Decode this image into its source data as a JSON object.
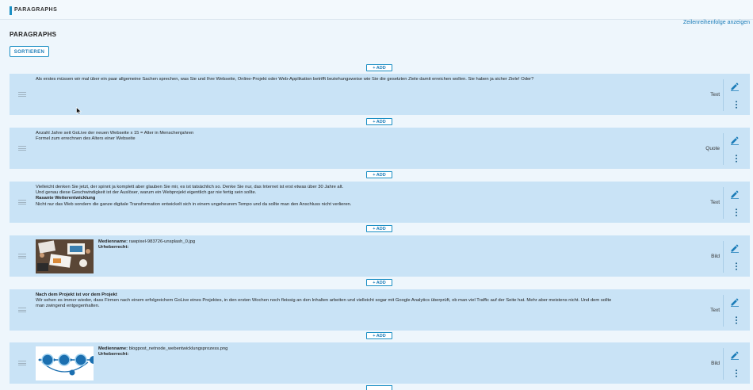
{
  "header": {
    "title": "PARAGRAPHS"
  },
  "order_link": "Zeilenreihenfolge anzeigen",
  "section_heading": "PARAGRAPHS",
  "sort_button": "SORTIEREN",
  "add_label": "+ ADD",
  "icons": {
    "drag": "drag-handle-icon",
    "edit": "pencil-icon",
    "more": "more-vert-icon"
  },
  "colors": {
    "accent": "#1b8fc4",
    "row_bg": "#c9e3f6",
    "page_bg": "#eef6fc"
  },
  "paragraphs": [
    {
      "type": "Text",
      "lines": [
        "Als erstes müssen wir mal über ein paar allgemeine Sachen sprechen, was Sie und Ihre Webseite, Online-Projekt oder Web-Applikation betrifft beziehungsweise wie Sie die gesetzten Ziele damit erreichen wollen. Sie haben ja sicher Ziele! Oder?"
      ]
    },
    {
      "type": "Quote",
      "lines": [
        "Anzahl Jahre seit GoLive der neuen Webseite x 15 = Alter in Menschenjahren",
        "Formel zum errechnen des Alters einer Webseite"
      ]
    },
    {
      "type": "Text",
      "lines": [
        "Vielleicht denken Sie jetzt, der spinnt ja komplett aber glauben Sie mir, es ist tatsächlich so. Denke Sie nur, das Internet ist erst etwas über 30 Jahre alt.",
        "Und genau diese Geschwindigkeit ist der Auslöser, warum ein Webprojekt eigentlich gar nie fertig sein sollte."
      ],
      "bold": "Rasante Weiterentwicklung",
      "after": "Nicht nur das Web sondern die ganze digitale Transformation entwickelt sich in einem ungeheurem Tempo und da sollte man den Anschluss nicht verlieren."
    },
    {
      "type": "Bild",
      "media_label": "Medienname:",
      "media_name": "rawpixel-983726-unsplash_0.jpg",
      "copyright_label": "Urheberrecht:"
    },
    {
      "type": "Text",
      "bold": "Nach dem Projekt ist vor dem Projekt",
      "lines": [
        "Wir sehen es immer wieder, dass Firmen nach einem erfolgreichem GoLive eines Projektes, in den ersten Wochen noch fleissig an den Inhalten arbeiten und vielleicht sogar mit Google Analytics überprüft, ob man viel Traffic auf der Seite hat. Mehr aber meistens nicht. Und dem sollte",
        "man zwingend entgegenhalten."
      ]
    },
    {
      "type": "Bild",
      "media_label": "Medienname:",
      "media_name": "blogpost_netnode_webentwicklungsprozess.png",
      "copyright_label": "Urheberrecht:"
    }
  ]
}
